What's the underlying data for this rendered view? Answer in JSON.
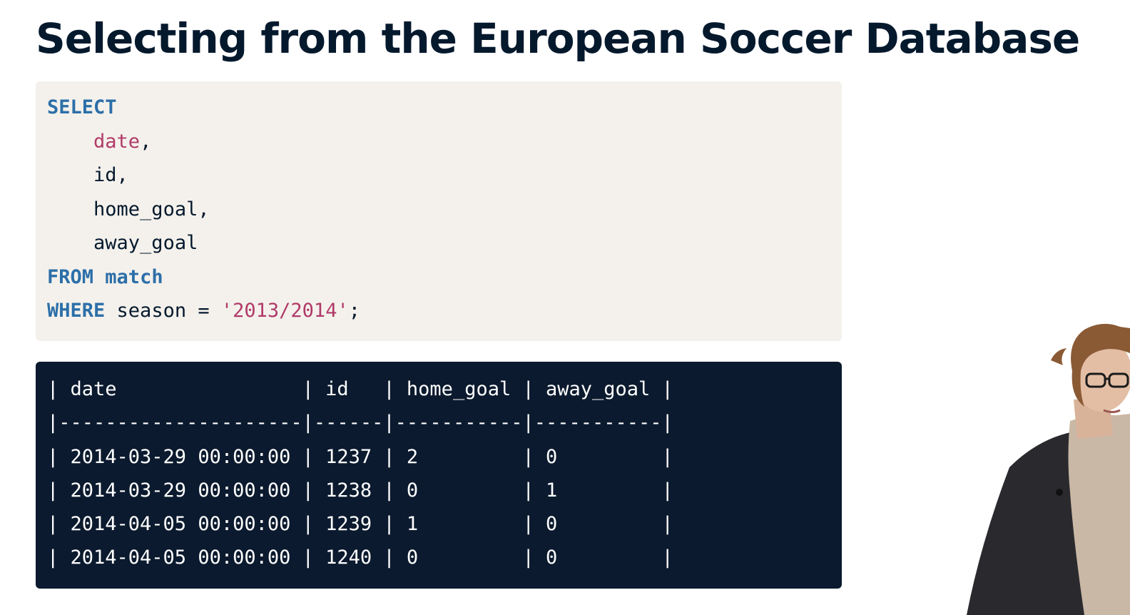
{
  "slide": {
    "title": "Selecting from the European Soccer Database"
  },
  "query": {
    "select_kw": "SELECT",
    "columns": [
      {
        "name": "date",
        "suffix": ","
      },
      {
        "name": "id",
        "suffix": ","
      },
      {
        "name": "home_goal",
        "suffix": ","
      },
      {
        "name": "away_goal",
        "suffix": ""
      }
    ],
    "from_kw": "FROM",
    "table": "match",
    "where_kw": "WHERE",
    "where_column": "season",
    "operator": "=",
    "where_value": "'2013/2014'",
    "terminator": ";"
  },
  "result": {
    "header_line": "| date                | id   | home_goal | away_goal |",
    "separator_line": "|---------------------|------|-----------|-----------|",
    "row_lines": [
      "| 2014-03-29 00:00:00 | 1237 | 2         | 0         |",
      "| 2014-03-29 00:00:00 | 1238 | 0         | 1         |",
      "| 2014-04-05 00:00:00 | 1239 | 1         | 0         |",
      "| 2014-04-05 00:00:00 | 1240 | 0         | 0         |"
    ],
    "columns": [
      "date",
      "id",
      "home_goal",
      "away_goal"
    ],
    "rows": [
      [
        "2014-03-29 00:00:00",
        "1237",
        "2",
        "0"
      ],
      [
        "2014-03-29 00:00:00",
        "1238",
        "0",
        "1"
      ],
      [
        "2014-04-05 00:00:00",
        "1239",
        "1",
        "0"
      ],
      [
        "2014-04-05 00:00:00",
        "1240",
        "0",
        "0"
      ]
    ]
  },
  "colors": {
    "title": "#05192d",
    "code_background": "#f4f1ec",
    "keyword": "#2c6fa8",
    "string_literal": "#b03a68",
    "result_background": "#0b1a2e",
    "result_text": "#ffffff"
  }
}
